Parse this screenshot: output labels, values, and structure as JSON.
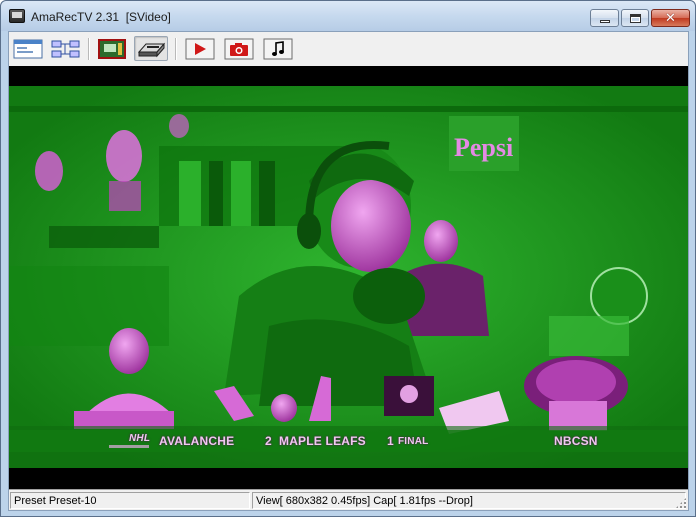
{
  "window": {
    "title": "AmaRecTV 2.31  [SVideo]"
  },
  "toolbar": {
    "buttons": [
      {
        "name": "window-icon",
        "pressed": false
      },
      {
        "name": "graph-icon",
        "pressed": false
      },
      {
        "name": "device-card-icon",
        "pressed": false
      },
      {
        "name": "capture-card-icon",
        "pressed": true
      },
      {
        "name": "record-play-icon",
        "pressed": false
      },
      {
        "name": "camera-icon",
        "pressed": false
      },
      {
        "name": "music-note-icon",
        "pressed": false
      }
    ]
  },
  "video": {
    "ticker": {
      "league": "NHL",
      "team1": "AVALANCHE",
      "score1": "2",
      "team2": "MAPLE LEAFS",
      "score2": "1",
      "status": "FINAL",
      "network": "NBCSN"
    },
    "sign_text": "Pepsi"
  },
  "statusbar": {
    "preset": "Preset Preset-10",
    "view_info": "View[ 680x382 0.45fps]  Cap[ 1.81fps --Drop]"
  },
  "colors": {
    "video_green": "#1c9a1c",
    "video_magenta": "#e070e0",
    "window_frame": "#bcd3ea"
  }
}
